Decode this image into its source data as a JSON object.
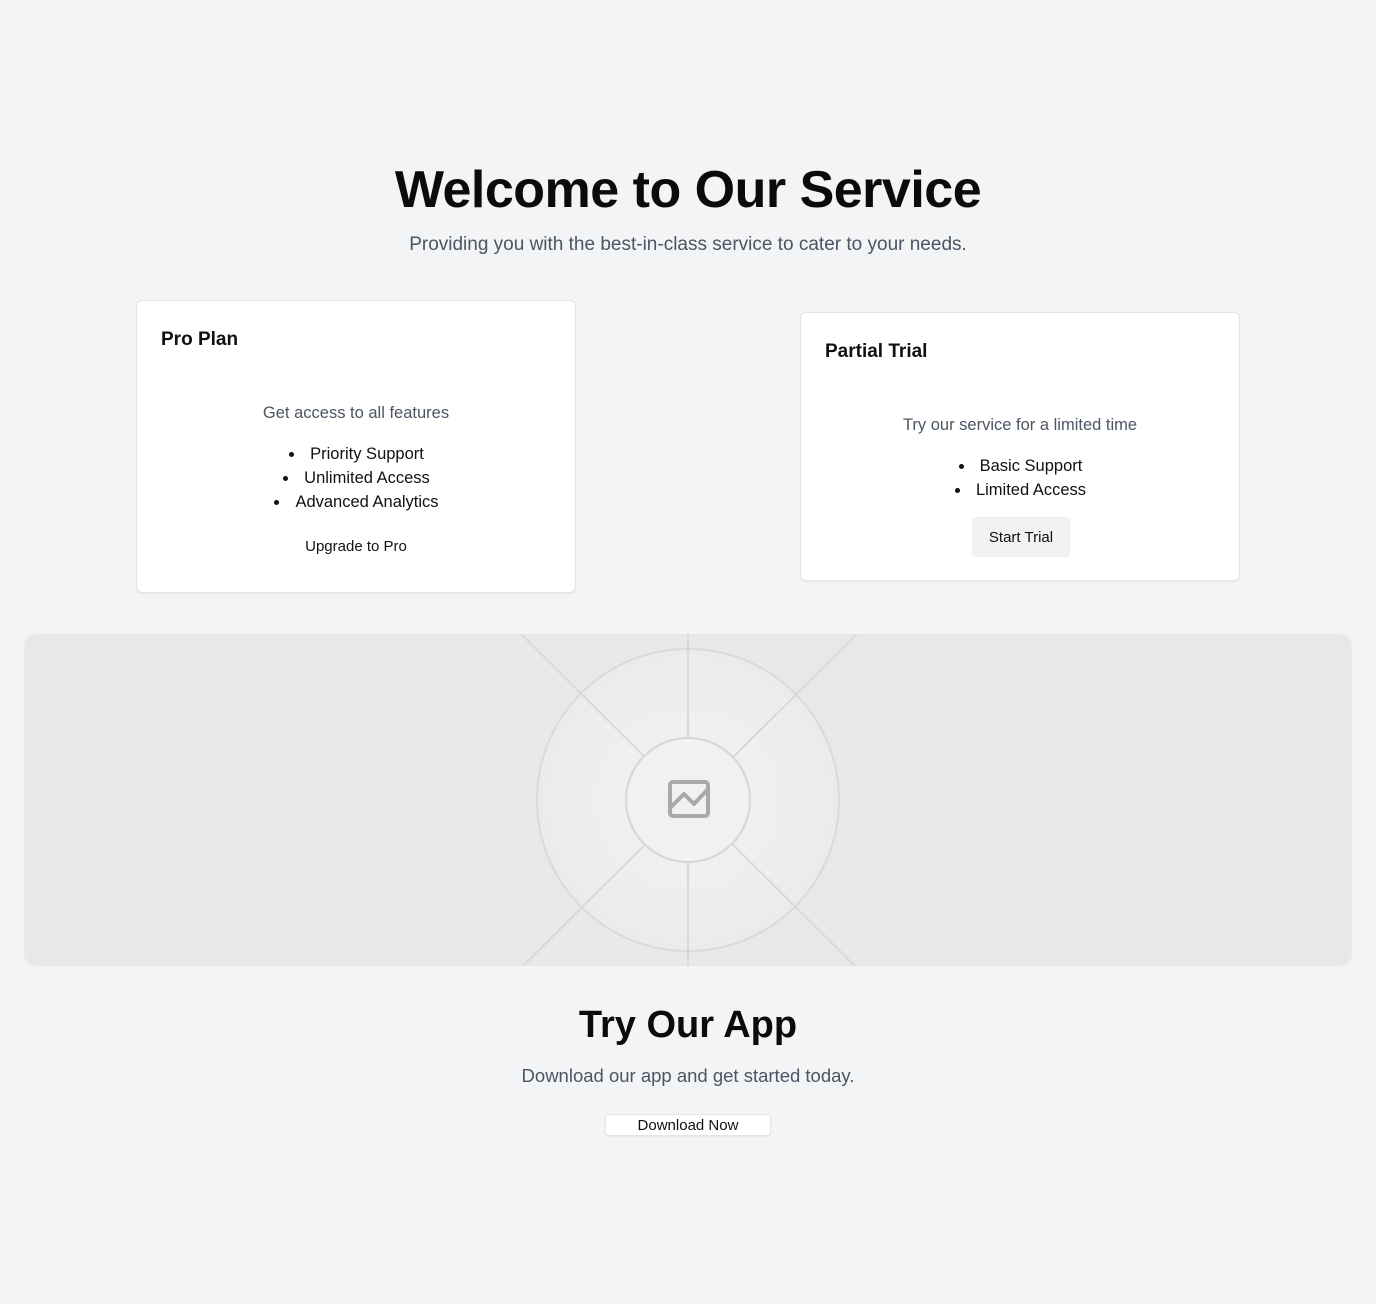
{
  "hero": {
    "title": "Welcome to Our Service",
    "subtitle": "Providing you with the best-in-class service to cater to your needs."
  },
  "plans": {
    "pro": {
      "title": "Pro Plan",
      "description": "Get access to all features",
      "features": [
        "Priority Support",
        "Unlimited Access",
        "Advanced Analytics"
      ],
      "button_label": "Upgrade to Pro"
    },
    "trial": {
      "title": "Partial Trial",
      "description": "Try our service for a limited time",
      "features": [
        "Basic Support",
        "Limited Access"
      ],
      "button_label": "Start Trial"
    }
  },
  "media": {
    "icon": "image-placeholder-icon"
  },
  "app": {
    "title": "Try Our App",
    "subtitle": "Download our app and get started today.",
    "button_label": "Download Now"
  },
  "colors": {
    "background": "#f3f4f6",
    "card_background": "#ffffff",
    "muted_text": "#4b5563",
    "heading_text": "#0b0b0b",
    "placeholder_background": "#e8e8e9"
  }
}
